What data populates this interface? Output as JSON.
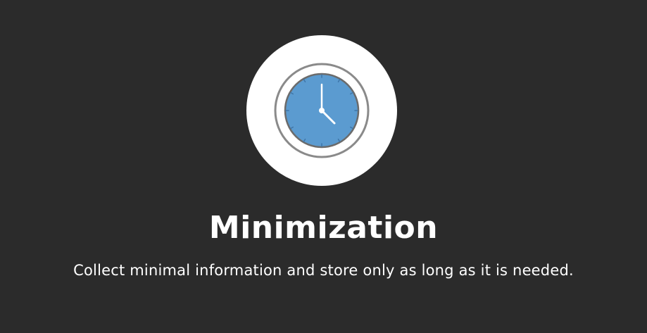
{
  "slide": {
    "title": "Minimization",
    "subtitle": "Collect minimal information and store only as long as it is needed.",
    "icon": "clock-icon"
  },
  "colors": {
    "background": "#2b2b2b",
    "icon_circle": "#ffffff",
    "clock_face": "#5b9bd0",
    "clock_ring": "#8a8a8a",
    "text": "#ffffff"
  }
}
